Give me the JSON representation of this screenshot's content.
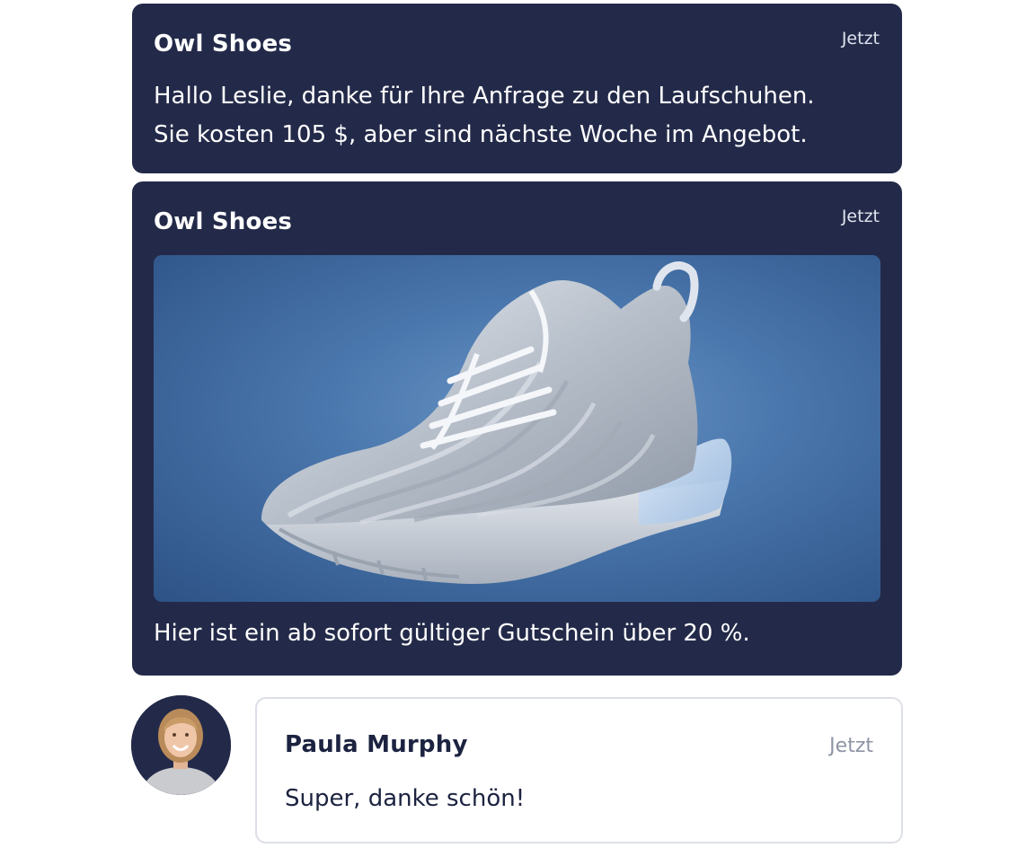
{
  "messages": [
    {
      "sender": "Owl Shoes",
      "time": "Jetzt",
      "lines": [
        "Hallo Leslie, danke für Ihre Anfrage zu den Laufschuhen.",
        "Sie kosten 105 $, aber sind nächste Woche im Angebot."
      ]
    },
    {
      "sender": "Owl Shoes",
      "time": "Jetzt",
      "image": "running-shoe-product-photo",
      "text": "Hier ist ein ab sofort gültiger Gutschein über 20 %."
    }
  ],
  "reply": {
    "sender": "Paula Murphy",
    "time": "Jetzt",
    "text": "Super, danke schön!",
    "avatar": "woman-avatar-photo"
  },
  "colors": {
    "card_bg": "#232a49",
    "card_text": "#ffffff",
    "reply_border": "#dcdfe7",
    "reply_text": "#1c2340",
    "muted_time": "#8d94a5"
  }
}
